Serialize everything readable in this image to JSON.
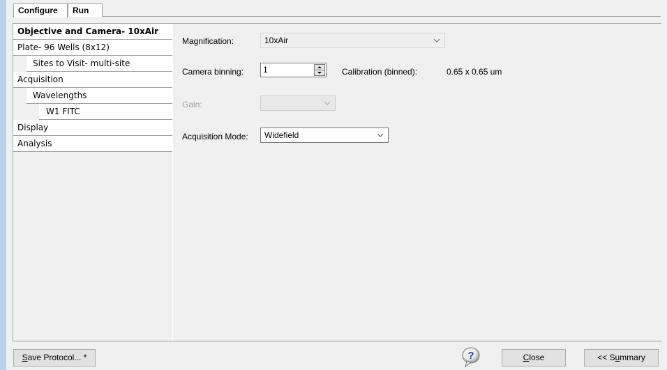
{
  "tabs": [
    {
      "label": "Configure"
    },
    {
      "label": "Run"
    }
  ],
  "nav": {
    "items": [
      {
        "label": "Objective and Camera- 10xAir"
      },
      {
        "label": "Plate- 96 Wells (8x12)"
      },
      {
        "label": "Sites to Visit- multi-site"
      },
      {
        "label": "Acquisition"
      },
      {
        "label": "Wavelengths"
      },
      {
        "label": "W1 FITC"
      },
      {
        "label": "Display"
      },
      {
        "label": "Analysis"
      }
    ]
  },
  "form": {
    "magnification": {
      "label": "Magnification:",
      "value": "10xAir"
    },
    "camera_binning": {
      "label": "Camera binning:",
      "value": "1"
    },
    "calibration": {
      "label": "Calibration (binned):",
      "value": "0.65 x 0.65 um"
    },
    "gain": {
      "label": "Gain:",
      "value": ""
    },
    "acquisition_mode": {
      "label": "Acquisition Mode:",
      "value": "Widefield"
    }
  },
  "footer": {
    "save_label_u": "S",
    "save_label_rest": "ave Protocol... *",
    "help_glyph": "?",
    "close_label_u": "C",
    "close_label_rest": "lose",
    "summary_prefix": "<< S",
    "summary_u": "u",
    "summary_rest": "mmary"
  },
  "icons": {
    "chevron": "chevron-down-icon",
    "help": "help-icon",
    "spin_up": "spin-up-icon",
    "spin_down": "spin-down-icon"
  }
}
